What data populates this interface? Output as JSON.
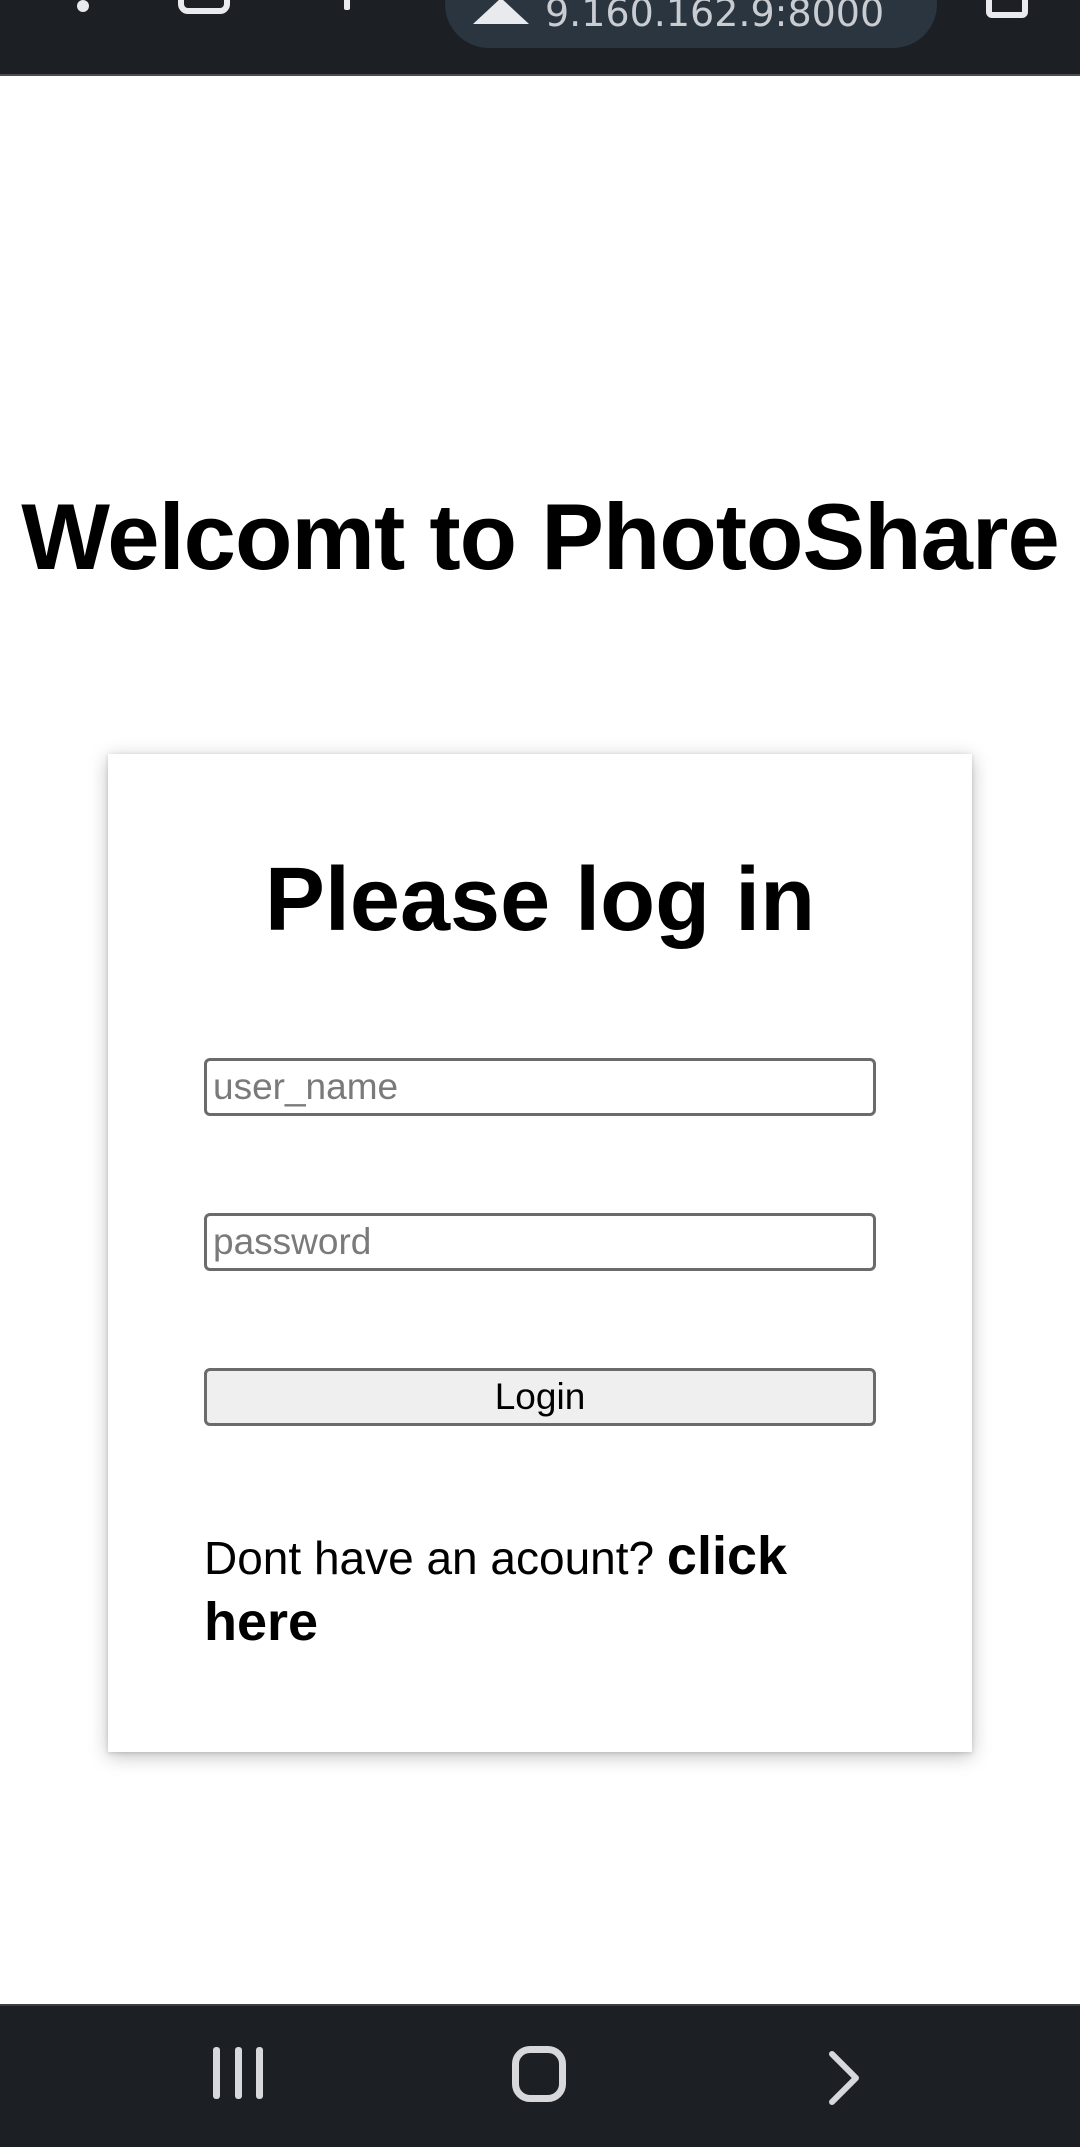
{
  "browser": {
    "url": "9.160.162.9:8000",
    "icons": [
      "menu-dots-icon",
      "tabs-icon",
      "new-tab-plus-icon",
      "warning-icon",
      "tab-switcher-icon"
    ]
  },
  "page": {
    "welcome_title": "Welcomt to PhotoShare"
  },
  "login_card": {
    "title": "Please log in",
    "username_placeholder": "user_name",
    "password_placeholder": "password",
    "login_label": "Login",
    "signup_prompt": "Dont have an acount?",
    "signup_link": "click here"
  },
  "nav_bar": {
    "icons": [
      "recents-icon",
      "home-icon",
      "back-icon"
    ]
  },
  "colors": {
    "system_bar": "#1c1f23",
    "url_pill": "#2b3540",
    "button_bg": "#efefef",
    "field_border": "#6b6b6b"
  }
}
